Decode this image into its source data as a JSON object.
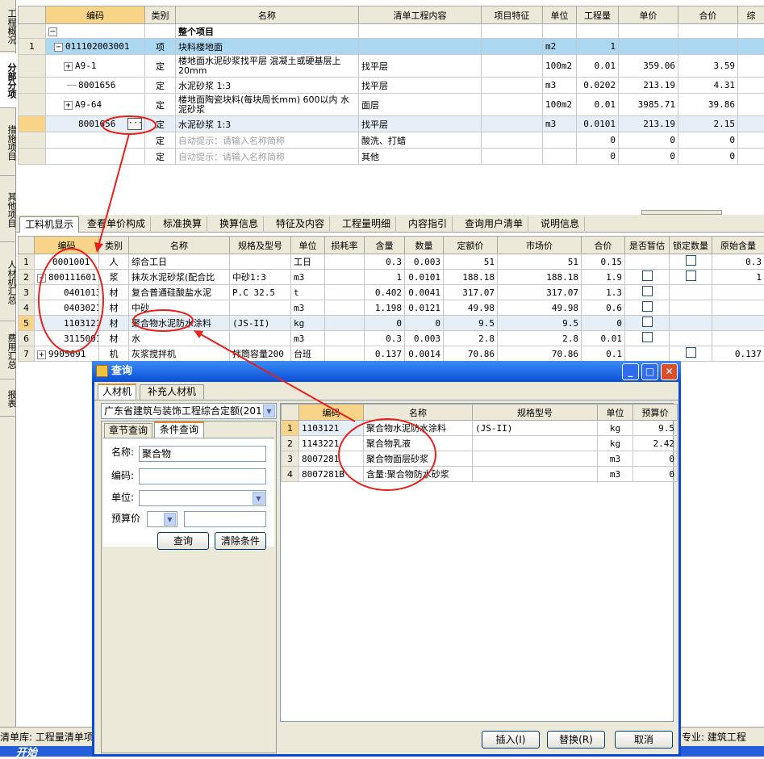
{
  "side_tabs": [
    "工程概况",
    "分部分项",
    "措施项目",
    "其他项目",
    "人材机汇总",
    "费用汇总",
    "报表"
  ],
  "top_grid": {
    "headers": [
      "编码",
      "类别",
      "名称",
      "清单工程内容",
      "项目特征",
      "单位",
      "工程量",
      "单价",
      "合价",
      "综"
    ],
    "section_title": "整个项目",
    "rows": [
      {
        "rn": "1",
        "code": "011102003001",
        "type": "项",
        "name": "块料楼地面",
        "content": "",
        "unit": "m2",
        "qty": "1",
        "price": "",
        "total": ""
      },
      {
        "rn": "",
        "code": "A9-1",
        "type": "定",
        "name": "楼地面水泥砂浆找平层 混凝土或硬基层上 20mm",
        "content": "找平层",
        "unit": "100m2",
        "qty": "0.01",
        "price": "359.06",
        "total": "3.59"
      },
      {
        "rn": "",
        "code": "8001656",
        "type": "定",
        "name": "水泥砂浆 1:3",
        "content": "找平层",
        "unit": "m3",
        "qty": "0.0202",
        "price": "213.19",
        "total": "4.31"
      },
      {
        "rn": "",
        "code": "A9-64",
        "type": "定",
        "name": "楼地面陶瓷块料(每块周长mm) 600以内 水泥砂浆",
        "content": "面层",
        "unit": "100m2",
        "qty": "0.01",
        "price": "3985.71",
        "total": "39.86"
      },
      {
        "rn": "",
        "code": "8001656",
        "type": "定",
        "name": "水泥砂浆 1:3",
        "content": "找平层",
        "unit": "m3",
        "qty": "0.0101",
        "price": "213.19",
        "total": "2.15"
      },
      {
        "rn": "",
        "code": "",
        "type": "定",
        "name": "自动提示：请输入名称简称",
        "content": "酸洗、打蜡",
        "unit": "",
        "qty": "0",
        "price": "0",
        "total": "0"
      },
      {
        "rn": "",
        "code": "",
        "type": "定",
        "name": "自动提示：请输入名称简称",
        "content": "其他",
        "unit": "",
        "qty": "0",
        "price": "0",
        "total": "0"
      }
    ],
    "ellipsis": "···"
  },
  "mid_tabs": [
    "工料机显示",
    "查看单价构成",
    "标准换算",
    "换算信息",
    "特征及内容",
    "工程量明细",
    "内容指引",
    "查询用户清单",
    "说明信息"
  ],
  "res_grid": {
    "headers": [
      "编码",
      "类别",
      "名称",
      "规格及型号",
      "单位",
      "损耗率",
      "含量",
      "数量",
      "定额价",
      "市场价",
      "合价",
      "是否暂估",
      "锁定数量",
      "原始含量"
    ],
    "rows": [
      {
        "rn": "1",
        "code": "0001001",
        "type": "人",
        "name": "综合工日",
        "spec": "",
        "unit": "工日",
        "loss": "",
        "content": "0.3",
        "qty": "0.003",
        "quota": "51",
        "market": "51",
        "total": "0.15",
        "orig": "0.3"
      },
      {
        "rn": "2",
        "code": "800111601",
        "type": "浆",
        "name": "抹灰水泥砂浆(配合比",
        "spec": "中砂1:3",
        "unit": "m3",
        "loss": "",
        "content": "1",
        "qty": "0.0101",
        "quota": "188.18",
        "market": "188.18",
        "total": "1.9",
        "orig": "1"
      },
      {
        "rn": "3",
        "code": "0401013",
        "type": "材",
        "name": "复合普通硅酸盐水泥",
        "spec": "P.C 32.5",
        "unit": "t",
        "loss": "",
        "content": "0.402",
        "qty": "0.0041",
        "quota": "317.07",
        "market": "317.07",
        "total": "1.3",
        "orig": ""
      },
      {
        "rn": "4",
        "code": "0403021",
        "type": "材",
        "name": "中砂",
        "spec": "",
        "unit": "m3",
        "loss": "",
        "content": "1.198",
        "qty": "0.0121",
        "quota": "49.98",
        "market": "49.98",
        "total": "0.6",
        "orig": ""
      },
      {
        "rn": "5",
        "code": "1103121",
        "type": "材",
        "name": "聚合物水泥防水涂料",
        "spec": "(JS-II)",
        "unit": "kg",
        "loss": "",
        "content": "0",
        "qty": "0",
        "quota": "9.5",
        "market": "9.5",
        "total": "0",
        "orig": ""
      },
      {
        "rn": "6",
        "code": "3115001",
        "type": "材",
        "name": "水",
        "spec": "",
        "unit": "m3",
        "loss": "",
        "content": "0.3",
        "qty": "0.003",
        "quota": "2.8",
        "market": "2.8",
        "total": "0.01",
        "orig": ""
      },
      {
        "rn": "7",
        "code": "9905691",
        "type": "机",
        "name": "灰浆搅拌机",
        "spec": "拌筒容量200",
        "unit": "台班",
        "loss": "",
        "content": "0.137",
        "qty": "0.0014",
        "quota": "70.86",
        "market": "70.86",
        "total": "0.1",
        "orig": "0.137"
      }
    ]
  },
  "status": {
    "left": "清单库: 工程量清单项",
    "right": "专业: 建筑工程"
  },
  "taskbar": {
    "start": "开始"
  },
  "dialog": {
    "title": "查询",
    "tabs": [
      "人材机",
      "补充人材机"
    ],
    "library": "广东省建筑与装饰工程综合定额(201",
    "sub_tabs": [
      "章节查询",
      "条件查询"
    ],
    "labels": {
      "name": "名称:",
      "code": "编码:",
      "unit": "单位:",
      "price": "预算价"
    },
    "values": {
      "name": "聚合物",
      "code": "",
      "unit": "",
      "price_op": "",
      "price": ""
    },
    "query_btn": "查询",
    "clear_btn": "清除条件",
    "result_headers": [
      "编码",
      "名称",
      "规格型号",
      "单位",
      "预算价"
    ],
    "results": [
      {
        "rn": "1",
        "code": "1103121",
        "name": "聚合物水泥防水涂料",
        "spec": "(JS-II)",
        "unit": "kg",
        "price": "9.5"
      },
      {
        "rn": "2",
        "code": "1143221",
        "name": "聚合物乳液",
        "spec": "",
        "unit": "kg",
        "price": "2.42"
      },
      {
        "rn": "3",
        "code": "8007281",
        "name": "聚合物面层砂浆",
        "spec": "",
        "unit": "m3",
        "price": "0"
      },
      {
        "rn": "4",
        "code": "8007281B",
        "name": "含量:聚合物防水砂浆",
        "spec": "",
        "unit": "m3",
        "price": "0"
      }
    ],
    "insert_btn": "插入(I)",
    "replace_btn": "替换(R)",
    "cancel_btn": "取消"
  },
  "colors": {
    "selected_row": "#add8f2",
    "header_sel": "#f8d488",
    "annotation": "#e8201a",
    "title_bar": "#0a4fd6"
  }
}
